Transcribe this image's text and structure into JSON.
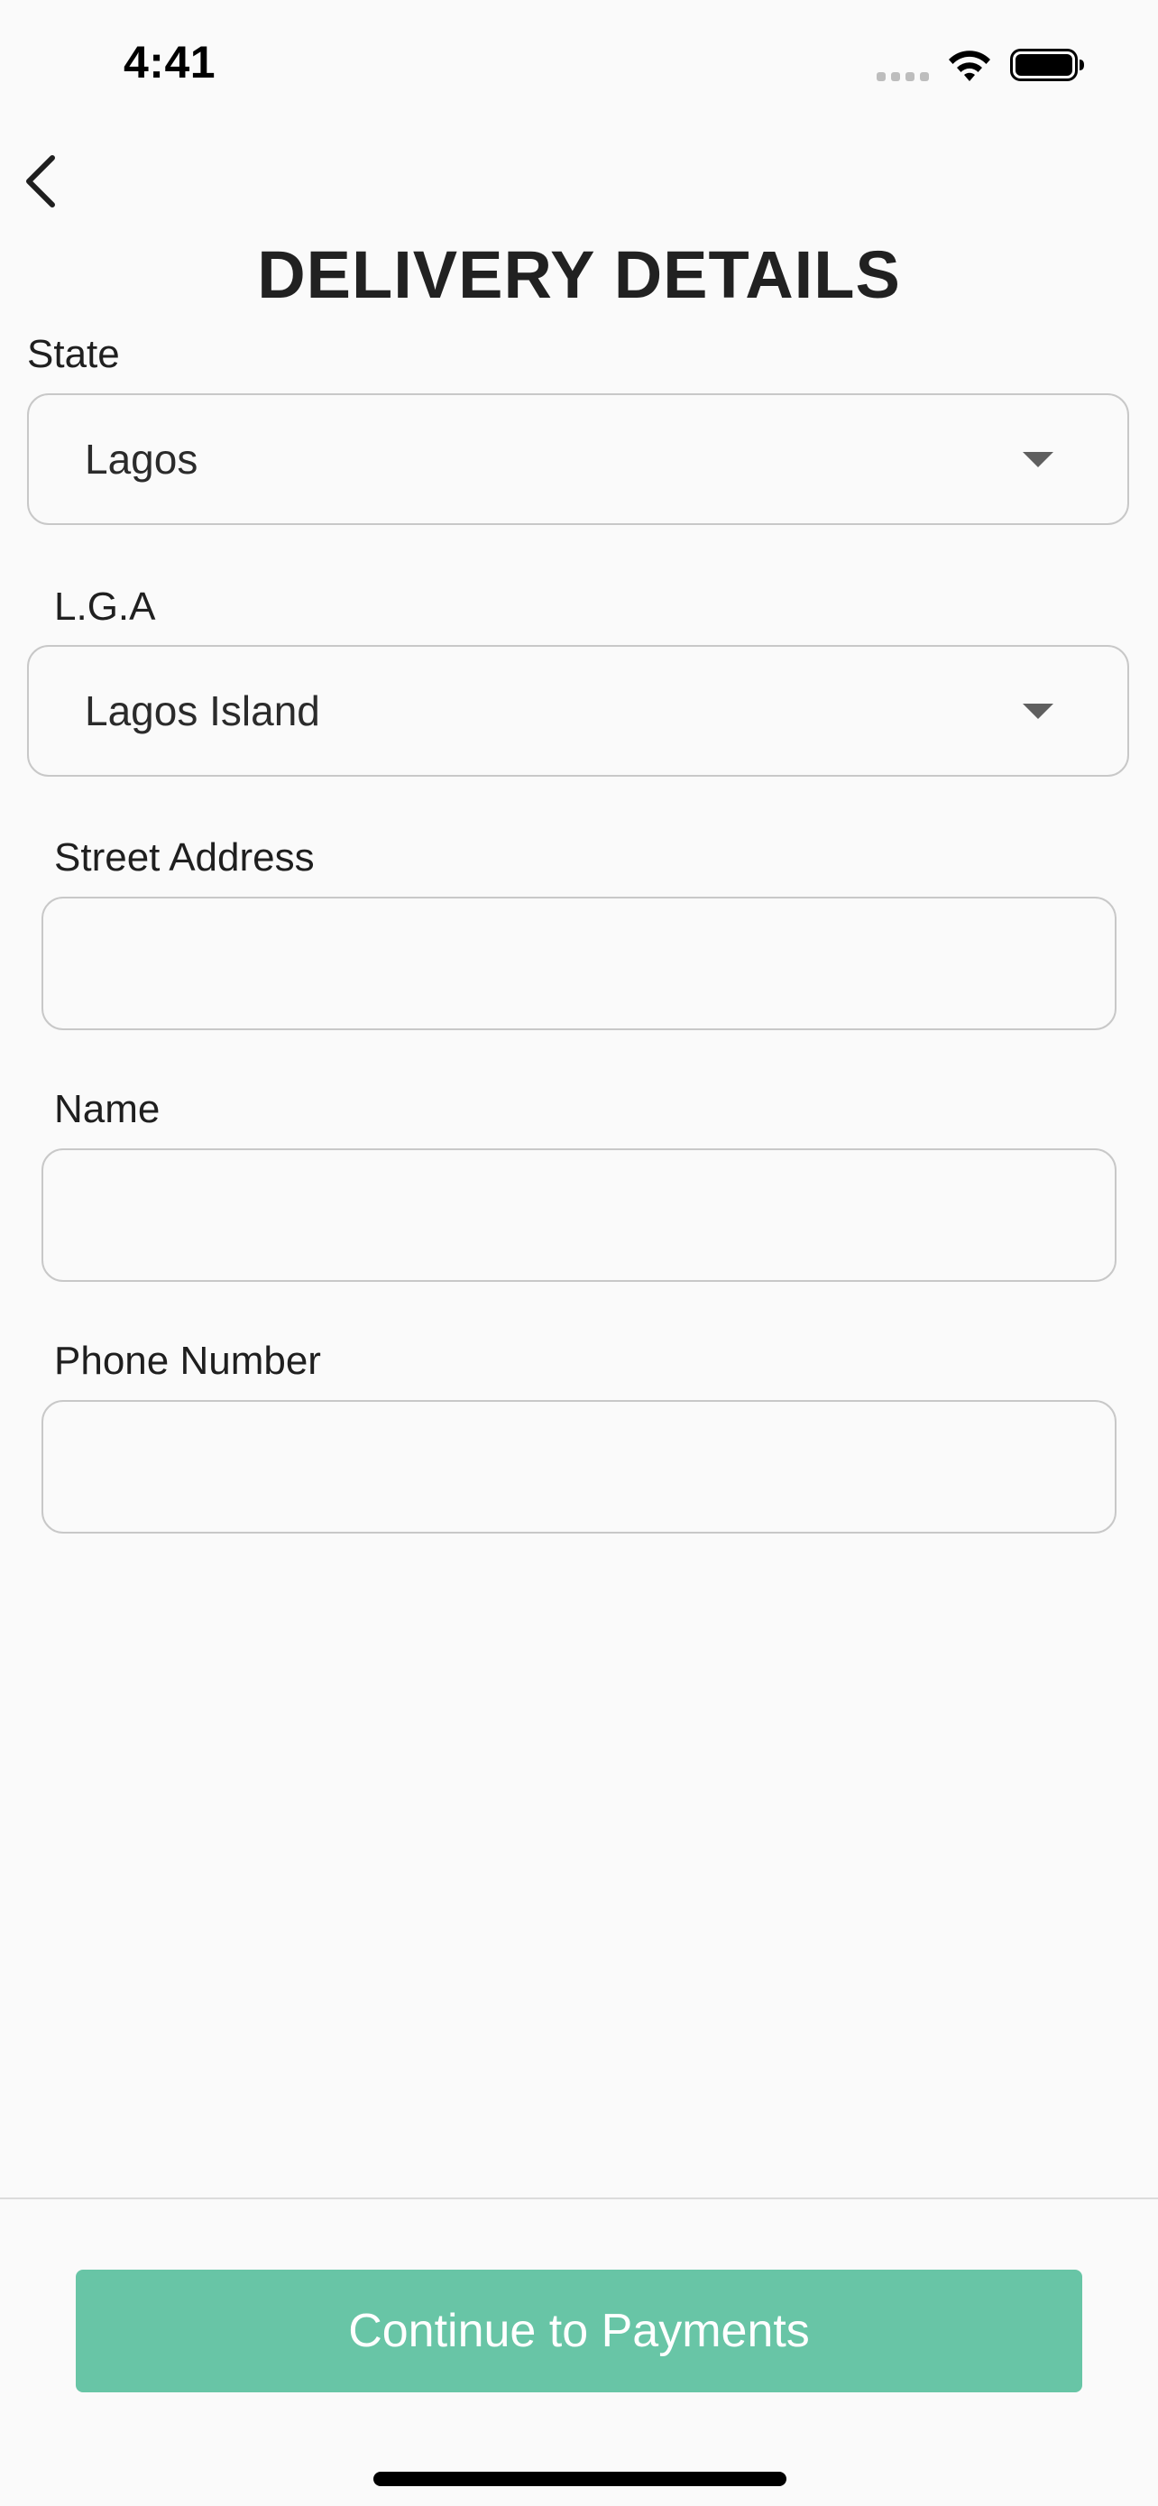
{
  "status_bar": {
    "time": "4:41",
    "signal_icon": "cellular-signal-icon",
    "wifi_icon": "wifi-icon",
    "battery_icon": "battery-full-icon"
  },
  "header": {
    "back_icon": "chevron-left-icon",
    "title": "DELIVERY DETAILS"
  },
  "form": {
    "state": {
      "label": "State",
      "value": "Lagos"
    },
    "lga": {
      "label": "L.G.A",
      "value": "Lagos Island"
    },
    "street_address": {
      "label": "Street Address",
      "value": "",
      "placeholder": ""
    },
    "name": {
      "label": "Name",
      "value": "",
      "placeholder": ""
    },
    "phone_number": {
      "label": "Phone Number",
      "value": "",
      "placeholder": ""
    }
  },
  "footer": {
    "continue_label": "Continue to Payments"
  },
  "colors": {
    "background": "#fafafa",
    "accent": "#68c5a6",
    "border": "#c8c8c8",
    "text": "#1f1f1f"
  }
}
